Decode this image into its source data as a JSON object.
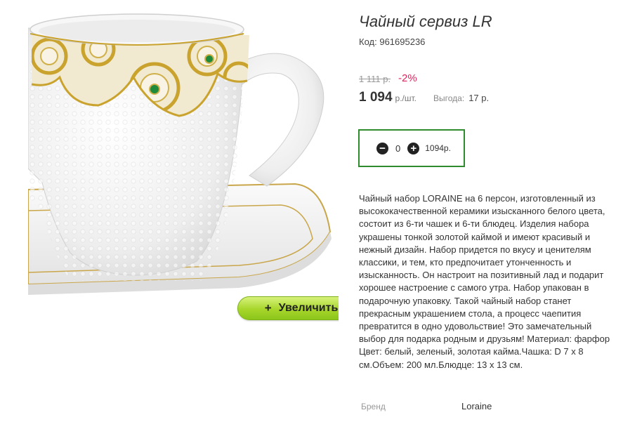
{
  "product": {
    "title": "Чайный сервиз LR",
    "code_label": "Код:",
    "code_value": "961695236",
    "old_price": "1 111 р.",
    "discount": "-2%",
    "price": "1 094",
    "price_unit": "р./шт.",
    "benefit_label": "Выгода:",
    "benefit_value": "17 р.",
    "description": "Чайный набор LORAINE на 6 персон, изготовленный из высококачественной керамики изысканного белого цвета, состоит из 6-ти чашек и 6-ти блюдец. Изделия набора украшены тонкой золотой каймой и имеют красивый и нежный дизайн. Набор придется по вкусу и ценителям классики, и тем, кто предпочитает утонченность и изысканность. Он настроит на позитивный лад и подарит хорошее настроение с самого утра. Набор упакован в подарочную упаковку. Такой чайный набор станет прекрасным украшением стола, а процесс чаепития превратится в одно удовольствие! Это замечательный выбор для подарка родным и друзьям! Материал: фарфор Цвет: белый, зеленый, золотая кайма.Чашка: D 7 х 8 см.Объем: 200 мл.Блюдце: 13 х 13 см.",
    "brand_label": "Бренд",
    "brand_value": "Loraine"
  },
  "cart": {
    "quantity": "0",
    "total": "1094р.",
    "minus_icon": "minus-circle-icon",
    "plus_icon": "plus-circle-icon"
  },
  "gallery": {
    "zoom_label": "Увеличить",
    "zoom_icon_glyph": "+"
  },
  "colors": {
    "accent_green": "#2e8b2e",
    "discount_red": "#e0245e",
    "zoom_button": "#a7d62a"
  }
}
